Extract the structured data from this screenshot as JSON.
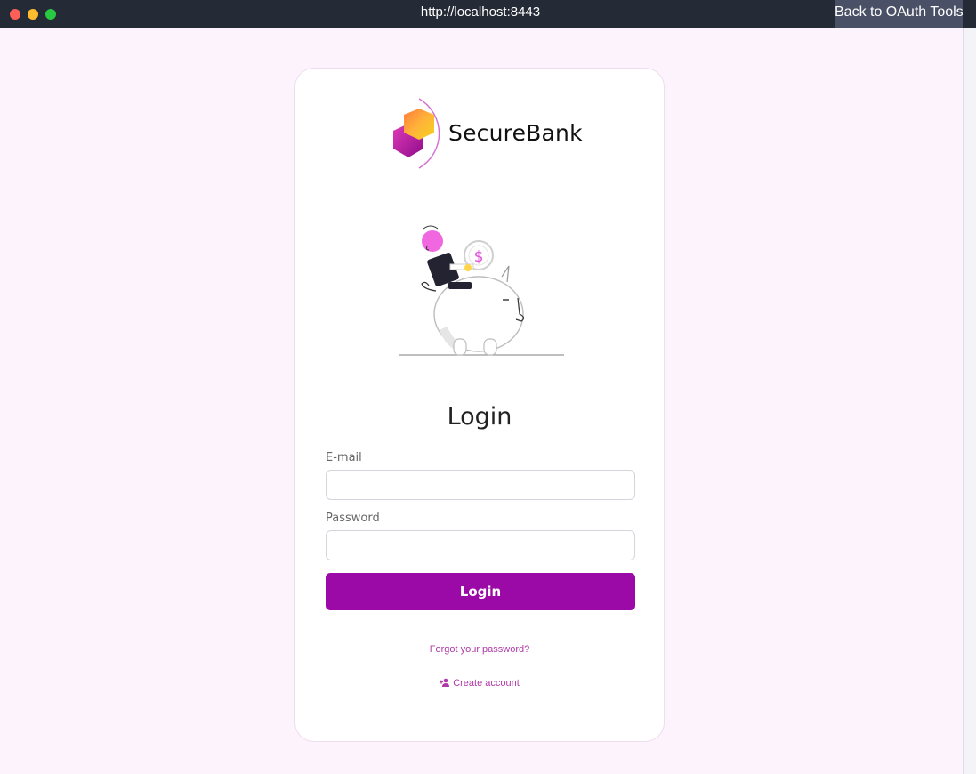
{
  "window": {
    "url": "http://localhost:8443",
    "back_button_label": "Back to OAuth Tools"
  },
  "brand": {
    "name": "SecureBank",
    "accent_color": "#9b0aa6"
  },
  "login": {
    "title": "Login",
    "email_label": "E-mail",
    "email_value": "",
    "password_label": "Password",
    "password_value": "",
    "submit_label": "Login",
    "forgot_password_label": "Forgot your password?",
    "create_account_label": "Create account",
    "create_account_icon": "add-user-icon"
  }
}
